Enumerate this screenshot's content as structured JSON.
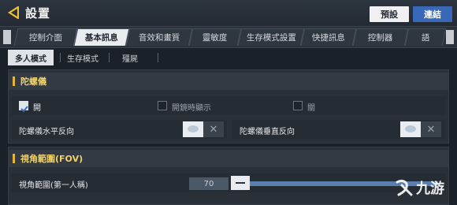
{
  "header": {
    "title": "設置",
    "default_label": "預設",
    "connect_label": "連結"
  },
  "tabs": [
    {
      "label": "控制介面",
      "active": false
    },
    {
      "label": "基本訊息",
      "active": true
    },
    {
      "label": "音效和畫質",
      "active": false
    },
    {
      "label": "靈敏度",
      "active": false
    },
    {
      "label": "生存模式設置",
      "active": false
    },
    {
      "label": "快捷訊息",
      "active": false
    },
    {
      "label": "控制器",
      "active": false
    },
    {
      "label": "語",
      "active": false
    }
  ],
  "subtabs": [
    {
      "label": "多人模式",
      "active": true
    },
    {
      "label": "生存模式",
      "active": false
    },
    {
      "label": "殭屍",
      "active": false
    }
  ],
  "gyro": {
    "title": "陀螺儀",
    "options": [
      {
        "label": "開",
        "checked": true
      },
      {
        "label": "開鏡時顯示",
        "checked": false
      },
      {
        "label": "關",
        "checked": false
      }
    ],
    "horizontal_label": "陀螺儀水平反向",
    "vertical_label": "陀螺儀垂直反向",
    "toggle_off_glyph": "✕"
  },
  "fov": {
    "title": "視角範圍(FOV)",
    "first_person_label": "視角範圍(第一人稱)",
    "value": "70",
    "fraction": 0.0
  },
  "watermark": {
    "text": "九游"
  }
}
